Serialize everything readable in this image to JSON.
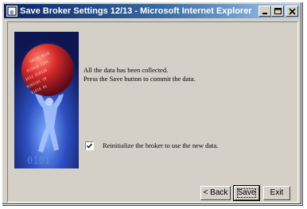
{
  "window": {
    "title": "Save Broker Settings 12/13 - Microsoft Internet Explorer",
    "controls": {
      "minimize": "minimize-icon",
      "maximize": "maximize-icon",
      "close": "close-icon"
    }
  },
  "message": {
    "line1": "All the data has been collected.",
    "line2": "Press the Save button to commit the data."
  },
  "reinitialize": {
    "checked": true,
    "label": "Reinitialize the broker to use the new data."
  },
  "buttons": {
    "back": "< Back",
    "save": "Save",
    "exit": "Exit"
  },
  "colors": {
    "title_active": "#0a246a",
    "face": "#d4d0c8",
    "graphic_bg": "#1b2a7a",
    "sphere": "#c8262b"
  }
}
